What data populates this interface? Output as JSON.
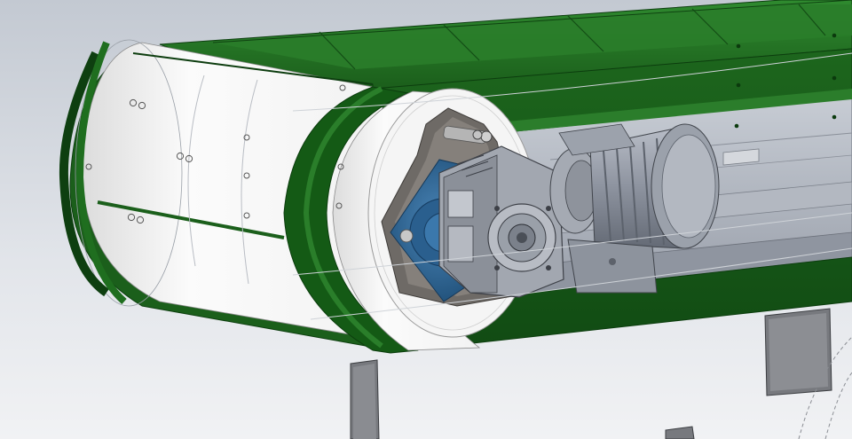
{
  "scene": {
    "subject": "CAD model",
    "colors": {
      "background_top": "#c9ced6",
      "background_bottom": "#eef0f3",
      "belt_green": "#1f6b1f",
      "belt_green_dark": "#0f4a12",
      "drum_white": "#f7f7f7",
      "motor_grey": "#8a909c",
      "gearbox_grey": "#9aa0aa",
      "bearing_blue": "#2f6a9b",
      "leg_grey": "#7d7f84"
    }
  }
}
